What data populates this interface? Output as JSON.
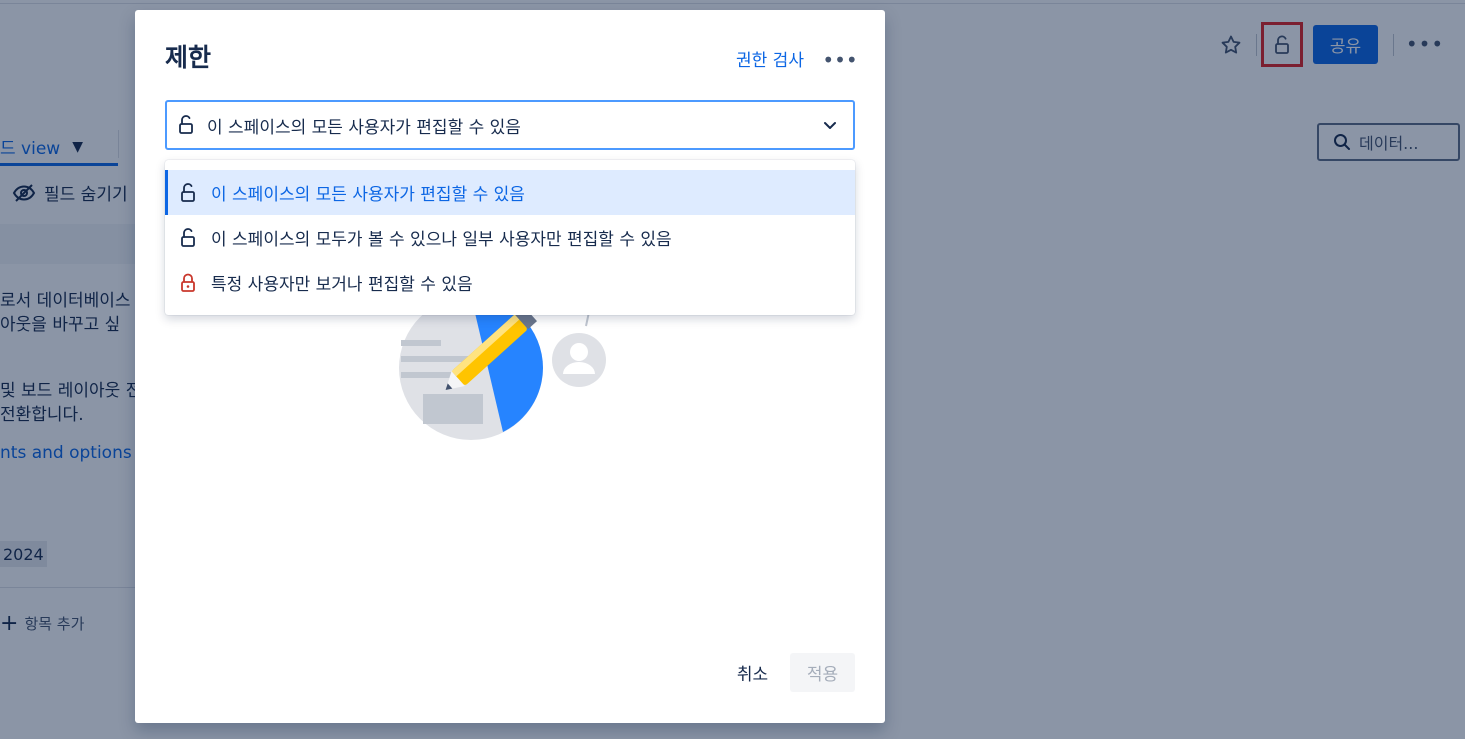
{
  "header": {
    "share_label": "공유",
    "star_icon": "star-icon",
    "lock_icon": "unlock-icon",
    "more_icon": "more-horizontal-icon"
  },
  "toolbar": {
    "view_label": "드 view",
    "search_placeholder": "데이터...",
    "hide_fields_label": "필드 숨기기"
  },
  "background_content": {
    "line1": "로서 데이터베이스",
    "line2": "아웃을 바꾸고 싶",
    "line3": "및 보드 레이아웃 전",
    "line4": "전환합니다.",
    "link_text": "nts and options | C",
    "year_badge": "2024",
    "add_item_label": "항목 추가"
  },
  "modal": {
    "title": "제한",
    "permission_check_link": "권한 검사",
    "select": {
      "value": "이 스페이스의 모든 사용자가 편집할 수 있음"
    },
    "options": [
      {
        "label": "이 스페이스의 모든 사용자가 편집할 수 있음",
        "icon": "unlock-icon",
        "selected": true
      },
      {
        "label": "이 스페이스의 모두가 볼 수 있으나 일부 사용자만 편집할 수 있음",
        "icon": "unlock-icon",
        "selected": false
      },
      {
        "label": "특정 사용자만 보거나 편집할 수 있음",
        "icon": "lock-icon",
        "selected": false
      }
    ],
    "cancel_label": "취소",
    "apply_label": "적용"
  },
  "colors": {
    "accent": "#0c66e4",
    "selected_bg": "#deebff",
    "focus_border": "#4c9aff",
    "restricted_lock": "#c9372c",
    "highlight_box": "#e02020"
  }
}
